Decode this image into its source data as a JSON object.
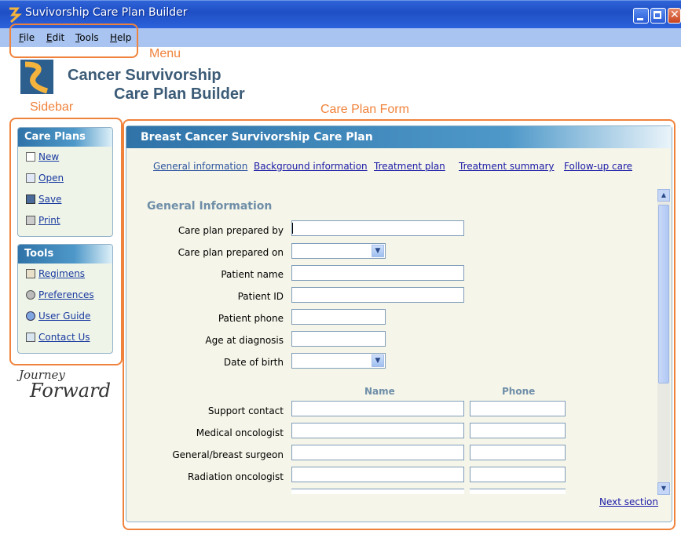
{
  "window": {
    "title": "Suvivorship Care Plan Builder"
  },
  "menu": {
    "items": [
      {
        "key": "F",
        "rest": "ile"
      },
      {
        "key": "E",
        "rest": "dit"
      },
      {
        "key": "T",
        "rest": "ools"
      },
      {
        "key": "H",
        "rest": "elp"
      }
    ]
  },
  "annotations": {
    "menu": "Menu",
    "sidebar": "Sidebar",
    "form": "Care Plan Form"
  },
  "logo": {
    "line1": "Cancer Survivorship",
    "line2": "Care Plan Builder"
  },
  "sidebar": {
    "care_plans": {
      "title": "Care Plans",
      "items": [
        {
          "label": "New",
          "icon": "new-document-icon"
        },
        {
          "label": "Open",
          "icon": "open-icon"
        },
        {
          "label": "Save",
          "icon": "save-icon"
        },
        {
          "label": "Print",
          "icon": "print-icon"
        }
      ]
    },
    "tools": {
      "title": "Tools",
      "items": [
        {
          "label": "Regimens",
          "icon": "regimens-icon"
        },
        {
          "label": "Preferences",
          "icon": "preferences-icon"
        },
        {
          "label": "User Guide",
          "icon": "user-guide-icon"
        },
        {
          "label": "Contact Us",
          "icon": "contact-icon"
        }
      ]
    },
    "tagline": {
      "line1": "Journey",
      "line2": "Forward"
    }
  },
  "form": {
    "title": "Breast Cancer Survivorship Care Plan",
    "tabs": [
      {
        "label": "General information",
        "active": true
      },
      {
        "label": "Background information",
        "active": false
      },
      {
        "label": "Treatment plan",
        "active": false
      },
      {
        "label": "Treatment summary",
        "active": false
      },
      {
        "label": "Follow-up care",
        "active": false
      }
    ],
    "section_title": "General Information",
    "fields": [
      {
        "label": "Care plan prepared by",
        "value": "",
        "type": "text-wide"
      },
      {
        "label": "Care plan prepared on",
        "value": "",
        "type": "dropdown"
      },
      {
        "label": "Patient name",
        "value": "",
        "type": "text-wide"
      },
      {
        "label": "Patient ID",
        "value": "",
        "type": "text-wide"
      },
      {
        "label": "Patient phone",
        "value": "",
        "type": "text-short"
      },
      {
        "label": "Age at diagnosis",
        "value": "",
        "type": "text-short"
      },
      {
        "label": "Date of birth",
        "value": "",
        "type": "dropdown"
      }
    ],
    "contacts": {
      "col_name": "Name",
      "col_phone": "Phone",
      "rows": [
        {
          "label": "Support contact",
          "name": "",
          "phone": ""
        },
        {
          "label": "Medical oncologist",
          "name": "",
          "phone": ""
        },
        {
          "label": "General/breast surgeon",
          "name": "",
          "phone": ""
        },
        {
          "label": "Radiation oncologist",
          "name": "",
          "phone": ""
        }
      ]
    },
    "next_label": "Next section"
  },
  "colors": {
    "accent": "#f0833c",
    "header_blue": "#2f73a8",
    "link": "#1a1aa8"
  }
}
